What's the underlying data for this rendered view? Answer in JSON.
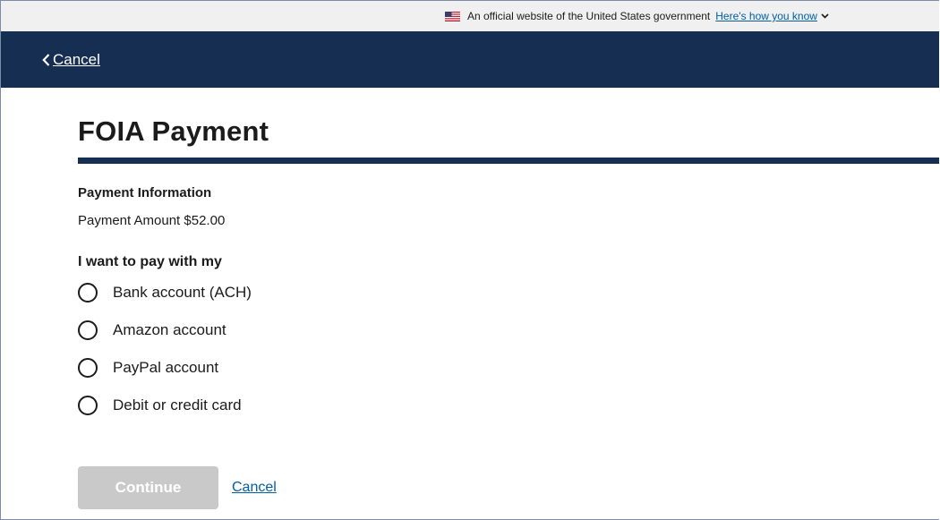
{
  "gov_banner": {
    "text": "An official website of the United States government",
    "link": "Here's how you know",
    "flag_icon": "us-flag-icon",
    "chevron_icon": "chevron-down-icon"
  },
  "header": {
    "back_label": "Cancel",
    "back_icon": "chevron-left-icon",
    "background_color": "#162e51"
  },
  "page": {
    "title": "FOIA Payment"
  },
  "payment_info": {
    "heading": "Payment Information",
    "amount_label": "Payment Amount",
    "amount_value": "$52.00"
  },
  "payment_method": {
    "legend": "I want to pay with my",
    "options": [
      {
        "label": "Bank account (ACH)",
        "selected": false
      },
      {
        "label": "Amazon account",
        "selected": false
      },
      {
        "label": "PayPal account",
        "selected": false
      },
      {
        "label": "Debit or credit card",
        "selected": false
      }
    ]
  },
  "actions": {
    "continue_label": "Continue",
    "continue_disabled": true,
    "cancel_label": "Cancel"
  },
  "colors": {
    "primary_dark": "#162e51",
    "link": "#005ea2",
    "disabled_button": "#c9c9c9"
  }
}
